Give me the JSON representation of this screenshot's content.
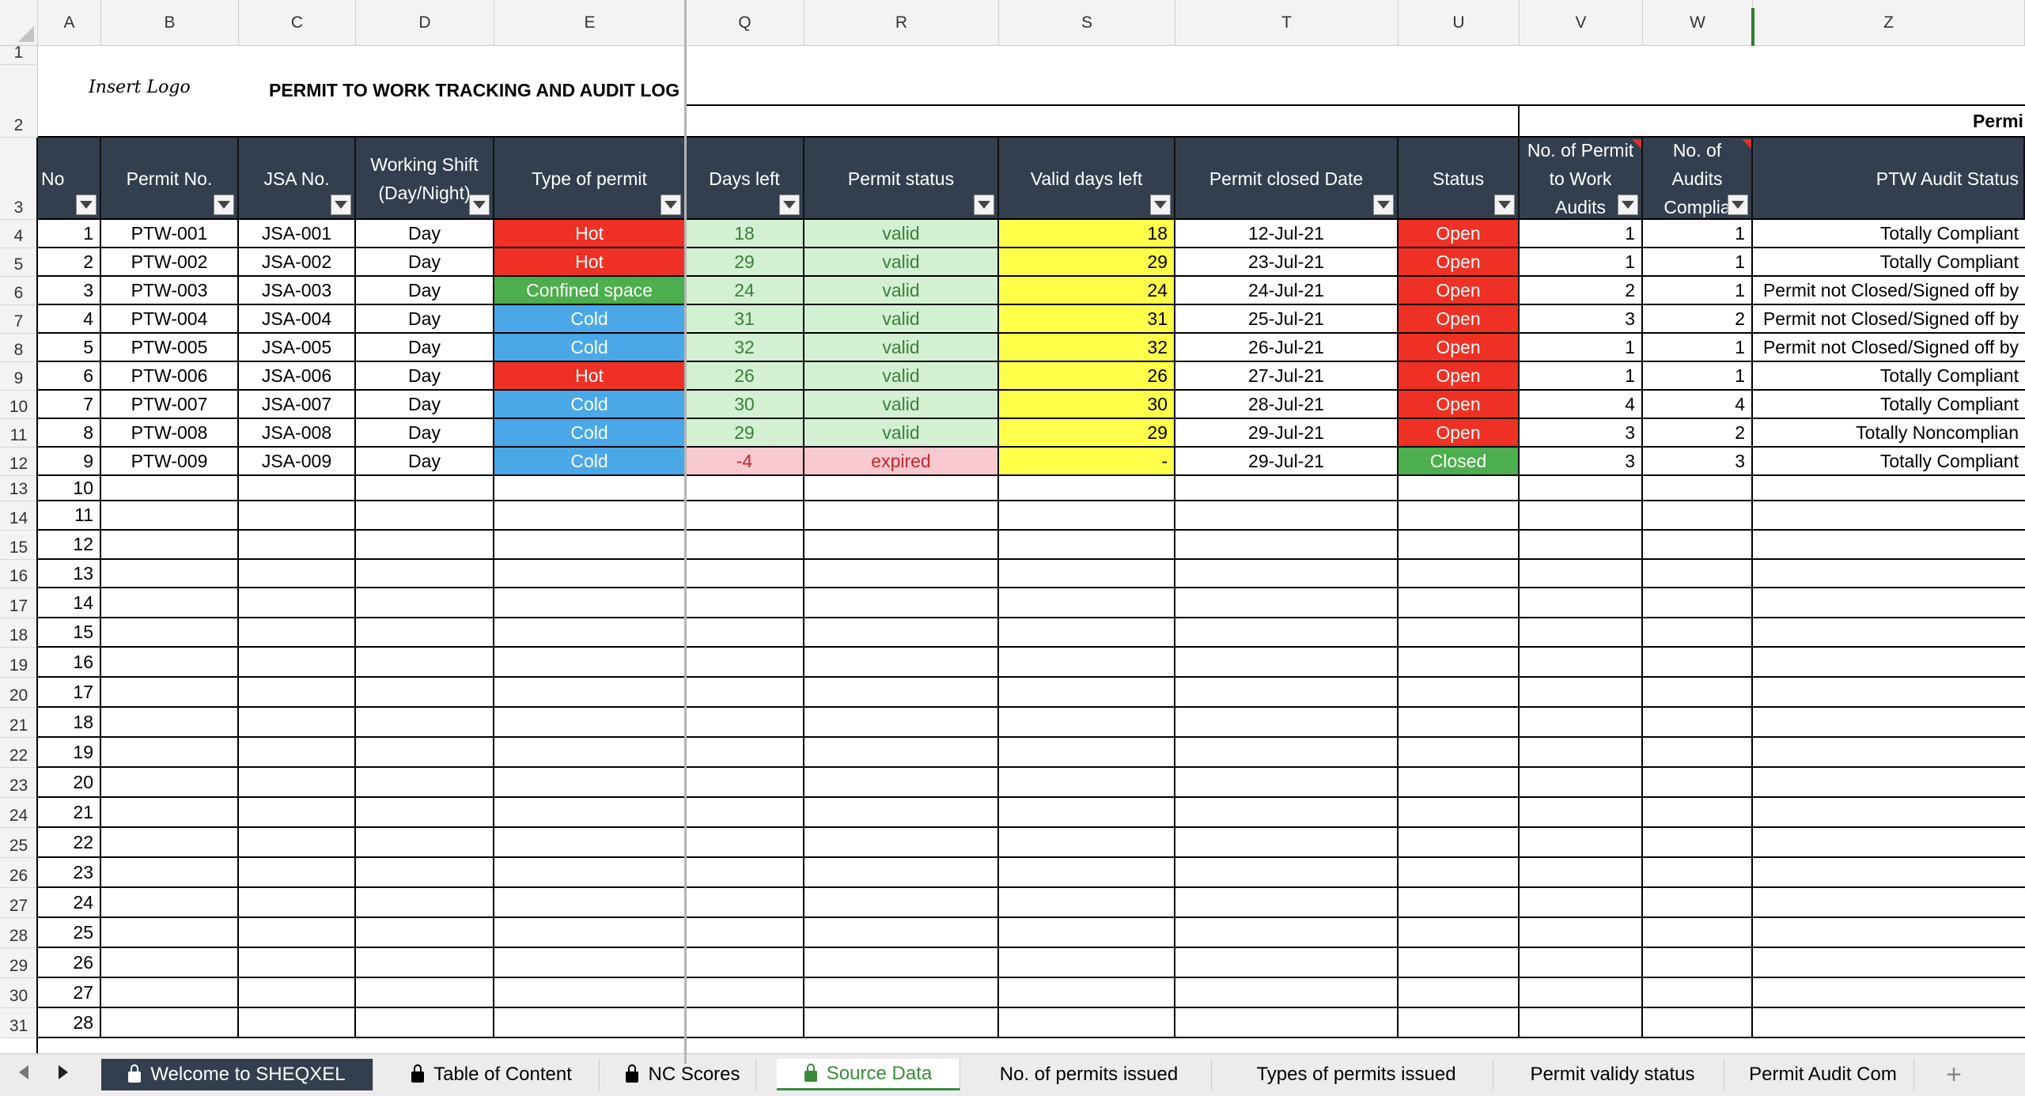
{
  "columns": [
    {
      "letter": "A",
      "key": "no"
    },
    {
      "letter": "B",
      "key": "permit"
    },
    {
      "letter": "C",
      "key": "jsa"
    },
    {
      "letter": "D",
      "key": "shift"
    },
    {
      "letter": "E",
      "key": "type"
    },
    {
      "letter": "Q",
      "key": "days"
    },
    {
      "letter": "R",
      "key": "pstatus"
    },
    {
      "letter": "S",
      "key": "valid"
    },
    {
      "letter": "T",
      "key": "closed"
    },
    {
      "letter": "U",
      "key": "status"
    },
    {
      "letter": "V",
      "key": "audits"
    },
    {
      "letter": "W",
      "key": "compliant"
    },
    {
      "letter": "Z",
      "key": "audit_status"
    }
  ],
  "title": {
    "logo_text": "Insert Logo",
    "main": "PERMIT TO WORK TRACKING AND AUDIT LOG",
    "right_partial": "Permi"
  },
  "headers": {
    "no": "No",
    "permit": "Permit No.",
    "jsa": "JSA No.",
    "shift_line1": "Working Shift",
    "shift_line2": "(Day/Night)",
    "type": "Type of permit",
    "days": "Days left",
    "pstatus": "Permit status",
    "valid": "Valid days left",
    "closed": "Permit closed Date",
    "status": "Status",
    "audits_line1": "No. of Permit",
    "audits_line2": "to Work",
    "audits_line3": "Audits",
    "compliant_line1": "No. of",
    "compliant_line2": "Audits",
    "compliant_line3": "Complia",
    "audit_status": "PTW Audit Status"
  },
  "rows": [
    {
      "no": "1",
      "permit": "PTW-001",
      "jsa": "JSA-001",
      "shift": "Day",
      "type": "Hot",
      "days": "18",
      "pstatus": "valid",
      "valid": "18",
      "closed": "12-Jul-21",
      "status": "Open",
      "audits": "1",
      "compliant": "1",
      "audit_status": "Totally Compliant"
    },
    {
      "no": "2",
      "permit": "PTW-002",
      "jsa": "JSA-002",
      "shift": "Day",
      "type": "Hot",
      "days": "29",
      "pstatus": "valid",
      "valid": "29",
      "closed": "23-Jul-21",
      "status": "Open",
      "audits": "1",
      "compliant": "1",
      "audit_status": "Totally Compliant"
    },
    {
      "no": "3",
      "permit": "PTW-003",
      "jsa": "JSA-003",
      "shift": "Day",
      "type": "Confined space",
      "days": "24",
      "pstatus": "valid",
      "valid": "24",
      "closed": "24-Jul-21",
      "status": "Open",
      "audits": "2",
      "compliant": "1",
      "audit_status": "Permit not Closed/Signed off by"
    },
    {
      "no": "4",
      "permit": "PTW-004",
      "jsa": "JSA-004",
      "shift": "Day",
      "type": "Cold",
      "days": "31",
      "pstatus": "valid",
      "valid": "31",
      "closed": "25-Jul-21",
      "status": "Open",
      "audits": "3",
      "compliant": "2",
      "audit_status": "Permit not Closed/Signed off by"
    },
    {
      "no": "5",
      "permit": "PTW-005",
      "jsa": "JSA-005",
      "shift": "Day",
      "type": "Cold",
      "days": "32",
      "pstatus": "valid",
      "valid": "32",
      "closed": "26-Jul-21",
      "status": "Open",
      "audits": "1",
      "compliant": "1",
      "audit_status": "Permit not Closed/Signed off by"
    },
    {
      "no": "6",
      "permit": "PTW-006",
      "jsa": "JSA-006",
      "shift": "Day",
      "type": "Hot",
      "days": "26",
      "pstatus": "valid",
      "valid": "26",
      "closed": "27-Jul-21",
      "status": "Open",
      "audits": "1",
      "compliant": "1",
      "audit_status": "Totally Compliant"
    },
    {
      "no": "7",
      "permit": "PTW-007",
      "jsa": "JSA-007",
      "shift": "Day",
      "type": "Cold",
      "days": "30",
      "pstatus": "valid",
      "valid": "30",
      "closed": "28-Jul-21",
      "status": "Open",
      "audits": "4",
      "compliant": "4",
      "audit_status": "Totally Compliant"
    },
    {
      "no": "8",
      "permit": "PTW-008",
      "jsa": "JSA-008",
      "shift": "Day",
      "type": "Cold",
      "days": "29",
      "pstatus": "valid",
      "valid": "29",
      "closed": "29-Jul-21",
      "status": "Open",
      "audits": "3",
      "compliant": "2",
      "audit_status": "Totally Noncomplian"
    },
    {
      "no": "9",
      "permit": "PTW-009",
      "jsa": "JSA-009",
      "shift": "Day",
      "type": "Cold",
      "days": "-4",
      "pstatus": "expired",
      "valid": "-",
      "closed": "29-Jul-21",
      "status": "Closed",
      "audits": "3",
      "compliant": "3",
      "audit_status": "Totally Compliant"
    }
  ],
  "row_numbers": [
    "1",
    "2",
    "3",
    "4",
    "5",
    "6",
    "7",
    "8",
    "9",
    "10",
    "11",
    "12",
    "13",
    "14",
    "15",
    "16",
    "17",
    "18",
    "19",
    "20",
    "21",
    "22",
    "23",
    "24",
    "25",
    "26",
    "27",
    "28",
    "29",
    "30",
    "31"
  ],
  "empty_no_values": [
    "10",
    "11",
    "12",
    "13",
    "14",
    "15",
    "16",
    "17",
    "18",
    "19",
    "20",
    "21",
    "22",
    "23",
    "24",
    "25",
    "26",
    "27",
    "28"
  ],
  "tabs": [
    {
      "label": "Welcome to SHEQXEL",
      "locked": true,
      "style": "dark"
    },
    {
      "label": "Table of Content",
      "locked": true,
      "style": "normal"
    },
    {
      "label": "NC Scores",
      "locked": true,
      "style": "normal"
    },
    {
      "label": "Source Data",
      "locked": true,
      "style": "active"
    },
    {
      "label": "No. of permits issued",
      "locked": false,
      "style": "normal"
    },
    {
      "label": "Types of permits issued",
      "locked": false,
      "style": "normal"
    },
    {
      "label": "Permit validy status",
      "locked": false,
      "style": "normal"
    },
    {
      "label": "Permit Audit Com",
      "locked": false,
      "style": "normal"
    }
  ],
  "add_sheet_label": "+",
  "colors": {
    "header_bg": "#333f4f",
    "hot": "#ee3124",
    "cold": "#4aa8e8",
    "confined": "#4cae4c",
    "valid_bg": "#d3f0d3",
    "valid_text": "#3a7f3a",
    "expired_bg": "#f8c9cf",
    "expired_text": "#c0282e",
    "yellow": "#ffff4a",
    "open": "#ee3124",
    "closed": "#4cae4c",
    "active_tab": "#3b8a3b"
  },
  "icons": {
    "filter": "filter-dropdown-icon",
    "lock": "lock-icon",
    "prev": "arrow-left-icon",
    "next": "arrow-right-icon"
  }
}
